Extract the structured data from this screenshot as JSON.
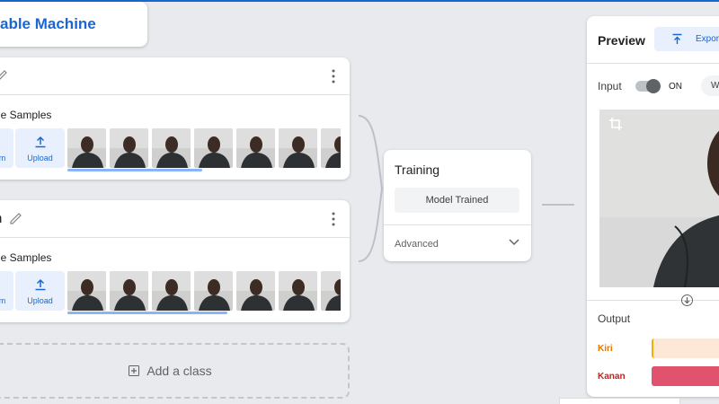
{
  "app": {
    "title": "able Machine"
  },
  "classes": [
    {
      "name": "",
      "samples_label": "ge Samples",
      "webcam_label": "m",
      "upload_label": "Upload",
      "thumb_count": 8
    },
    {
      "name": "n",
      "samples_label": "ge Samples",
      "webcam_label": "m",
      "upload_label": "Upload",
      "thumb_count": 8
    }
  ],
  "add_class": {
    "label": "Add a class"
  },
  "training": {
    "title": "Training",
    "button": "Model Trained",
    "advanced": "Advanced"
  },
  "preview": {
    "title": "Preview",
    "export_label": "Expor",
    "input_label": "Input",
    "toggle_state": "ON",
    "source_chip": "W",
    "output_label": "Output",
    "results": [
      {
        "label": "Kiri",
        "color": "#e37400",
        "bar_color": "#fde8d7",
        "accent": "#f9ab00"
      },
      {
        "label": "Kanan",
        "color": "#c5221f",
        "bar_color": "#e0526e",
        "accent": "#e0526e"
      }
    ]
  },
  "colors": {
    "accent": "#1967d2",
    "background": "#e8eaed"
  }
}
